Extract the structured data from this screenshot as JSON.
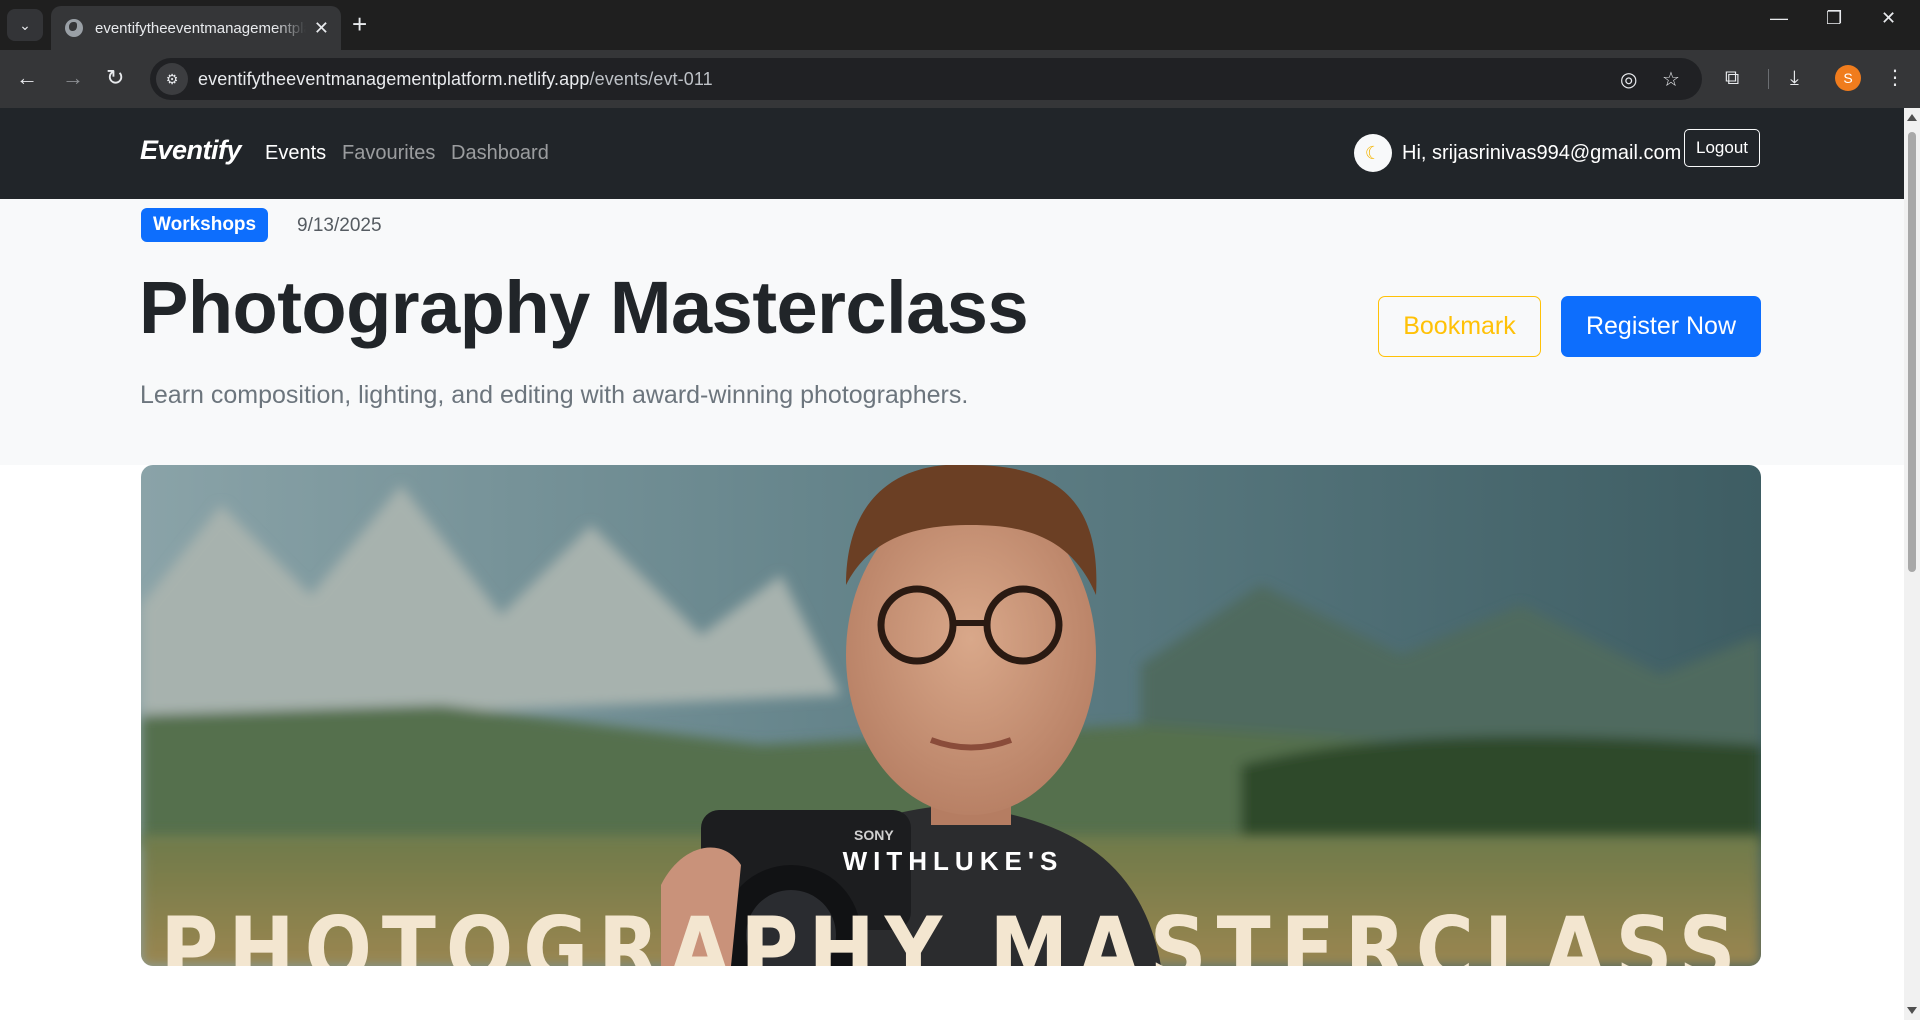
{
  "browser": {
    "tab_title": "eventifytheeventmanagementplatform.netlify.app",
    "url_host": "eventifytheeventmanagementplatform.netlify.app",
    "url_path": "/events/evt-011",
    "profile_initial": "S"
  },
  "navbar": {
    "brand": "Eventify",
    "links": [
      "Events",
      "Favourites",
      "Dashboard"
    ],
    "active_link": "Events",
    "theme_icon": "moon-icon",
    "greeting": "Hi, srijasrinivas994@gmail.com",
    "logout_label": "Logout"
  },
  "event": {
    "category": "Workshops",
    "date": "9/13/2025",
    "title": "Photography Masterclass",
    "description": "Learn composition, lighting, and editing with award-winning photographers.",
    "bookmark_label": "Bookmark",
    "register_label": "Register Now",
    "cover": {
      "overlay_small": "WITHLUKE'S",
      "overlay_large": "PHOTOGRAPHY MASTERCLASS",
      "camera_brand": "SONY"
    }
  },
  "colors": {
    "primary": "#0d6efd",
    "warning": "#ffc107",
    "navbar_bg": "#212529",
    "hero_bg": "#f8f9fa"
  }
}
